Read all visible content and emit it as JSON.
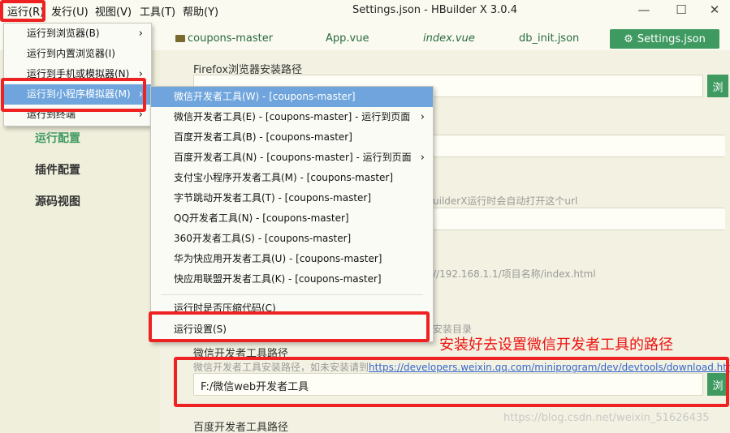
{
  "menubar": {
    "items": [
      "运行(R)",
      "发行(U)",
      "视图(V)",
      "工具(T)",
      "帮助(Y)"
    ]
  },
  "window": {
    "title": "Settings.json - HBuilder X 3.0.4",
    "minimize": "—",
    "maximize": "☐",
    "close": "✕"
  },
  "tabs": {
    "items": [
      "coupons-master",
      "App.vue",
      "index.vue",
      "db_init.json"
    ],
    "active": "Settings.json"
  },
  "left_nav": {
    "items": [
      "运行配置",
      "插件配置",
      "源码视图"
    ]
  },
  "editor": {
    "firefox_label": "Firefox浏览器安装路径",
    "browse": "浏",
    "hint_url": "uilderX运行时会自动打开这个url",
    "hint_ip": "//192.168.1.1/项目名称/index.html",
    "hint_dir": "安装目录",
    "wechat_label": "微信开发者工具路径",
    "wechat_hint_prefix": "微信开发者工具安装路径，如未安装请到",
    "wechat_link": "https://developers.weixin.qq.com/miniprogram/dev/devtools/download.htm",
    "wechat_value": "F:/微信web开发者工具",
    "baidu_label": "百度开发者工具路径"
  },
  "menu_main": {
    "items": [
      "运行到浏览器(B)",
      "运行到内置浏览器(I)",
      "运行到手机或模拟器(N)",
      "运行到小程序模拟器(M)",
      "运行到终端"
    ]
  },
  "menu_sub": {
    "items": [
      "微信开发者工具(W) - [coupons-master]",
      "微信开发者工具(E) - [coupons-master] - 运行到页面",
      "百度开发者工具(B) - [coupons-master]",
      "百度开发者工具(N) - [coupons-master] - 运行到页面",
      "支付宝小程序开发者工具(M) - [coupons-master]",
      "字节跳动开发者工具(T) - [coupons-master]",
      "QQ开发者工具(N) - [coupons-master]",
      "360开发者工具(S) - [coupons-master]",
      "华为快应用开发者工具(U) - [coupons-master]",
      "快应用联盟开发者工具(K) - [coupons-master]",
      "运行时是否压缩代码(C)",
      "运行设置(S)"
    ]
  },
  "annotation": "安装好去设置微信开发者工具的路径",
  "watermark": "https://blog.csdn.net/weixin_51626435",
  "colors": {
    "accent": "#3f9a61",
    "highlight": "#6fa5dc",
    "annotation": "#ee2222"
  }
}
